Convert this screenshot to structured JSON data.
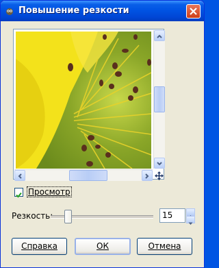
{
  "window": {
    "title": "Повышение резкости",
    "app_icon": "gimp-icon",
    "close_icon": "close-icon"
  },
  "preview": {
    "image_desc": "yellow-flower-macro",
    "toggle_label": "Просмотр",
    "toggle_checked": true
  },
  "sharpness": {
    "label": "Резкость:",
    "value": "15"
  },
  "buttons": {
    "help": "Справка",
    "ok": "ОК",
    "cancel": "Отмена"
  },
  "colors": {
    "titlebar": "#0054e3",
    "dialog_bg": "#ece9d8",
    "close_button": "#cf3e17"
  }
}
